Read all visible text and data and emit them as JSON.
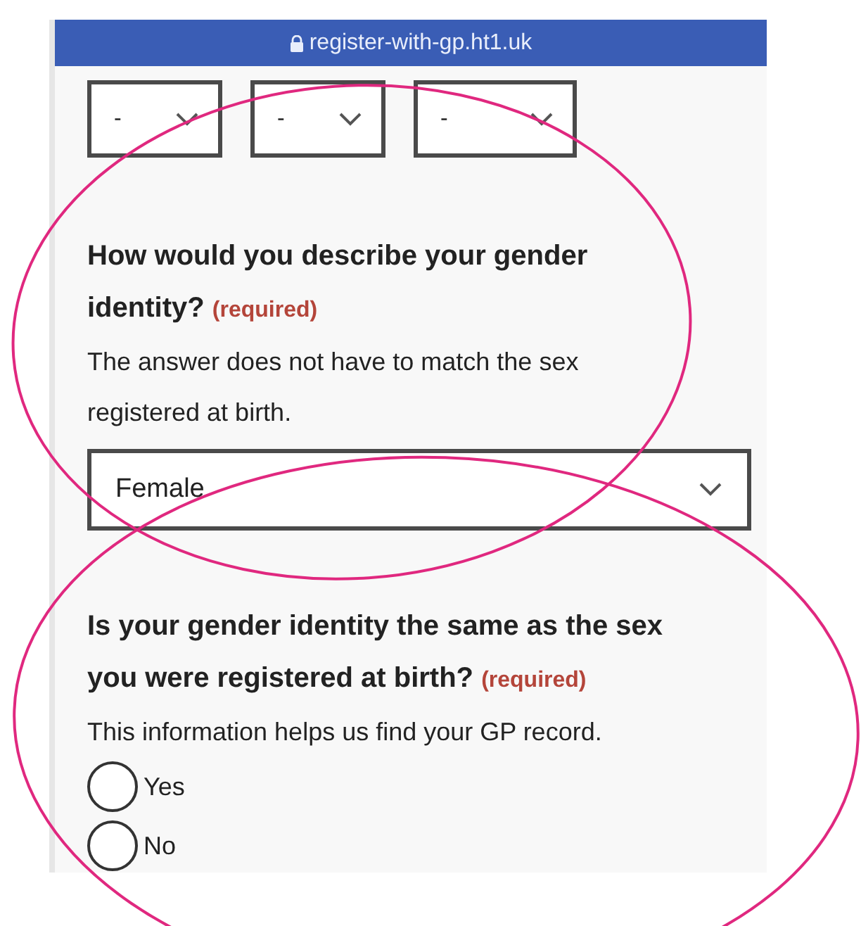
{
  "address_bar": {
    "url": "register-with-gp.ht1.uk"
  },
  "date_selects": [
    {
      "value": "-"
    },
    {
      "value": "-"
    },
    {
      "value": "-"
    }
  ],
  "questions": [
    {
      "kind": "select",
      "label": "How would you describe your gender identity?",
      "required": "(required)",
      "hint": "The answer does not have to match the sex registered at birth.",
      "value": "Female"
    },
    {
      "kind": "radio",
      "label": "Is your gender identity the same as the sex you were registered at birth?",
      "required": "(required)",
      "hint": "This information helps us find your GP record.",
      "options": [
        {
          "label": "Yes",
          "selected": false
        },
        {
          "label": "No",
          "selected": false
        }
      ]
    }
  ],
  "annotations": [
    {
      "kind": "ellipse"
    },
    {
      "kind": "ellipse"
    }
  ]
}
